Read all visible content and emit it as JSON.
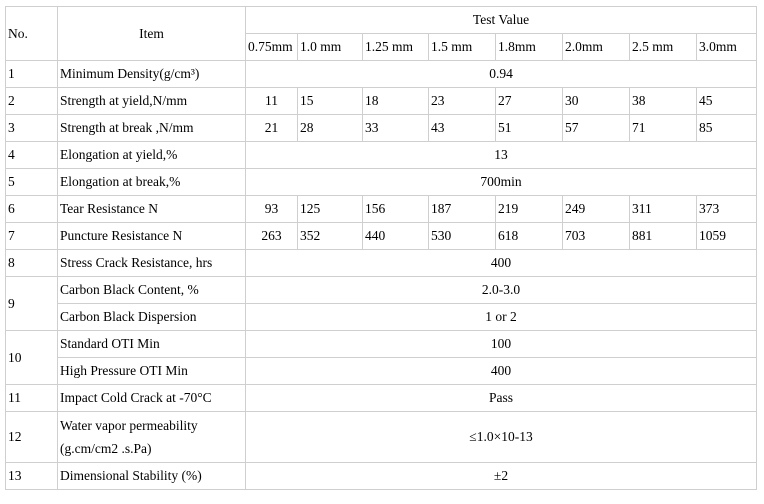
{
  "header": {
    "no": "No.",
    "item": "Item",
    "test_value": "Test Value",
    "thicknesses": [
      "0.75mm",
      "1.0 mm",
      "1.25 mm",
      "1.5 mm",
      "1.8mm",
      "2.0mm",
      "2.5 mm",
      "3.0mm"
    ]
  },
  "rows": [
    {
      "no": "1",
      "items": [
        {
          "item": "Minimum Density(g/cm³)",
          "value": "0.94"
        }
      ]
    },
    {
      "no": "2",
      "items": [
        {
          "item": "Strength at yield,N/mm",
          "values": [
            "11",
            "15",
            "18",
            "23",
            "27",
            "30",
            "38",
            "45"
          ]
        }
      ]
    },
    {
      "no": "3",
      "items": [
        {
          "item": "Strength at break ,N/mm",
          "values": [
            "21",
            "28",
            "33",
            "43",
            "51",
            "57",
            "71",
            "85"
          ]
        }
      ]
    },
    {
      "no": "4",
      "items": [
        {
          "item": "Elongation at yield,%",
          "value": "13"
        }
      ]
    },
    {
      "no": "5",
      "items": [
        {
          "item": "Elongation at break,%",
          "value": "700min"
        }
      ]
    },
    {
      "no": "6",
      "items": [
        {
          "item": "Tear Resistance N",
          "values": [
            "93",
            "125",
            "156",
            "187",
            "219",
            "249",
            "311",
            "373"
          ]
        }
      ]
    },
    {
      "no": "7",
      "items": [
        {
          "item": "Puncture Resistance N",
          "values": [
            "263",
            "352",
            "440",
            "530",
            "618",
            "703",
            "881",
            "1059"
          ]
        }
      ]
    },
    {
      "no": "8",
      "items": [
        {
          "item": "Stress Crack Resistance, hrs",
          "value": "400"
        }
      ]
    },
    {
      "no": "9",
      "items": [
        {
          "item": "Carbon Black Content, %",
          "value": "2.0-3.0"
        },
        {
          "item": "Carbon Black Dispersion",
          "value": "1 or 2"
        }
      ]
    },
    {
      "no": "10",
      "items": [
        {
          "item": "Standard OTI Min",
          "value": "100"
        },
        {
          "item": "High Pressure OTI Min",
          "value": "400"
        }
      ]
    },
    {
      "no": "11",
      "items": [
        {
          "item": "Impact Cold Crack at -70°C",
          "value": "Pass"
        }
      ]
    },
    {
      "no": "12",
      "items": [
        {
          "item": "Water vapor permeability (g.cm/cm2 .s.Pa)",
          "value": "≤1.0×10-13"
        }
      ]
    },
    {
      "no": "13",
      "items": [
        {
          "item": "Dimensional Stability (%)",
          "value": "±2"
        }
      ]
    }
  ]
}
